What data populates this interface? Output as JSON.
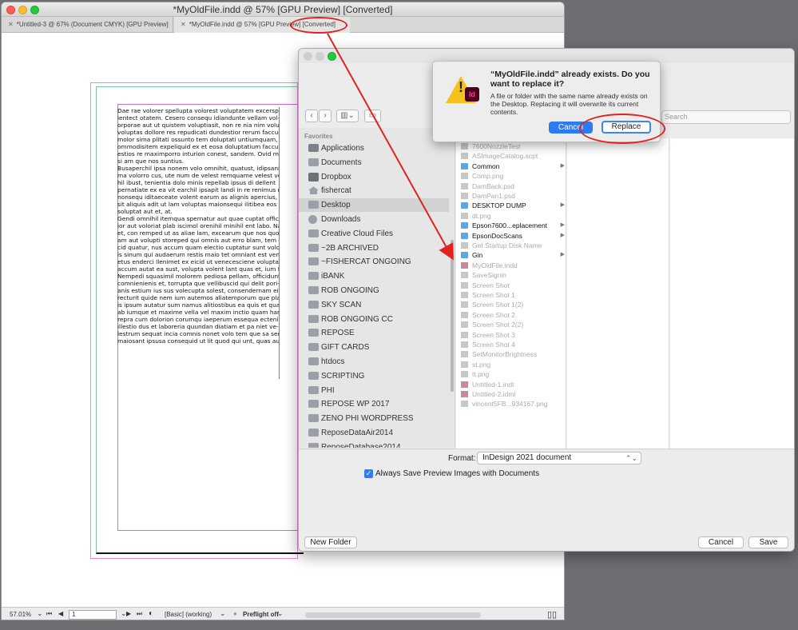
{
  "main_window": {
    "title": "*MyOldFile.indd @ 57% [GPU Preview] [Converted]",
    "tabs": [
      {
        "label": "*Untitled-3 @ 67% (Document CMYK) [GPU Preview]"
      },
      {
        "label": "*MyOldFile.indd @ 57% [GPU Preview] [Converted]"
      }
    ],
    "text_lines": [
      "Dae rae volorer spellupta volorest voluptatem excersp",
      "ientect otatem. Cesero consequ idiandunte vellam vol-",
      "orporae aut ut quistem voluptiasit, non re nia nim volupta",
      "voluptas dollore res repudicati dundestior rerum faccus",
      "molor sima plitati ossunto tem doluptati untiumquam,",
      "ommodisitem expeliquid ex et eosa doluptatium faccull",
      "estios re maximporro inturion conest, sandem. Ovid molor",
      "si am que nos suntius.",
      "Busaperchil ipsa nonem volo omnihit, quatust, idipsanis",
      "ma volorro cus, ute num de velest remquame velest veni-",
      "hil ibust, tenientia dolo minis repellab ipsus di dellent",
      "pernatiate ex ea vit earchil ipsapit landi in re renimus ne",
      "nonsequ iditaeceate volent earum as alignis apercius,",
      "sit aliquis adit ut lam voluptas maionsequi ilitibea eos",
      "soluptat aut et, at.",
      "Gendi omnihil itemqua spernatur aut quae cuptat officid-",
      "ior aut voloriat plab iscimol orenihil minihil ent labo. Nam",
      "et, con remped ut as aliae lam, excearum que nos quodit",
      "am aut volupti storeped qui omnis aut erro blam, tem quis-",
      "cid quatur, nus accum quam electio cuptatur sunt volorem",
      "is sinum qui audaerum restis maio tet omniant est vent",
      "etus enderci llenimet ex eicid ut venecesciene voluptati",
      "accum autat ea sust, volupta volent lant quas et, ium fuga.",
      "Nempedi squasimil molorem pediosa pellam, officidunti",
      "comnienienis et, torrupta que vellibuscid qui delit pori-",
      "anis estium ius sus volecupta solest, consendernam eium",
      "recturit quide nem ium autemos aliatemporum que plab",
      "is ipsum autatur sum namus alitiostibus ea quis et quam",
      "ab iumque et maxime vella vel maxim inctio quam harunt",
      "repra cum dolorion corumqu iaeperum essequa ectenih",
      "illestio dus et laboreria quundan diatiam et pa niet ve-",
      "lestrum sequat incia comnis nonet volo tem que sa sed",
      "maiosant ipsusa consequid ut lit quod qui unt, quas aut"
    ],
    "status": {
      "zoom": "57.01%",
      "page": "1",
      "style": "[Basic] (working)",
      "preflight": "Preflight off"
    }
  },
  "save_dialog": {
    "search_placeholder": "Search",
    "sidebar_header": "Favorites",
    "sidebar_items": [
      {
        "label": "Applications",
        "icon": "applications-icon"
      },
      {
        "label": "Documents",
        "icon": "documents-icon"
      },
      {
        "label": "Dropbox",
        "icon": "dropbox-icon"
      },
      {
        "label": "fishercat",
        "icon": "home-icon"
      },
      {
        "label": "Desktop",
        "icon": "desktop-icon",
        "selected": true
      },
      {
        "label": "Downloads",
        "icon": "downloads-icon"
      },
      {
        "label": "Creative Cloud Files",
        "icon": "folder-icon"
      },
      {
        "label": "~2B ARCHIVED",
        "icon": "folder-icon"
      },
      {
        "label": "~FISHERCAT ONGOING",
        "icon": "folder-icon"
      },
      {
        "label": "iBANK",
        "icon": "folder-icon"
      },
      {
        "label": "ROB ONGOING",
        "icon": "folder-icon"
      },
      {
        "label": "SKY SCAN",
        "icon": "folder-icon"
      },
      {
        "label": "ROB ONGOING CC",
        "icon": "folder-icon"
      },
      {
        "label": "REPOSE",
        "icon": "folder-icon"
      },
      {
        "label": "GIFT CARDS",
        "icon": "folder-icon"
      },
      {
        "label": "htdocs",
        "icon": "folder-icon"
      },
      {
        "label": "SCRIPTING",
        "icon": "folder-icon"
      },
      {
        "label": "PHI",
        "icon": "folder-icon"
      },
      {
        "label": "REPOSE WP 2017",
        "icon": "folder-icon"
      },
      {
        "label": "ZENO PHI WORDPRESS",
        "icon": "folder-icon"
      },
      {
        "label": "ReposeDataAir2014",
        "icon": "folder-icon"
      },
      {
        "label": "ReposeDatabase2014",
        "icon": "folder-icon"
      }
    ],
    "files": [
      {
        "name": "7600NozzleTest",
        "kind": "file"
      },
      {
        "name": "ASImageCatalog.scpt",
        "kind": "file"
      },
      {
        "name": "Common",
        "kind": "folder"
      },
      {
        "name": "Comp.png",
        "kind": "file"
      },
      {
        "name": "DamBack.psd",
        "kind": "file"
      },
      {
        "name": "DamPan1.psd",
        "kind": "file"
      },
      {
        "name": "DESKTOP DUMP",
        "kind": "folder"
      },
      {
        "name": "dt.png",
        "kind": "file"
      },
      {
        "name": "Epson7600...eplacement",
        "kind": "folder"
      },
      {
        "name": "EpsonDocScans",
        "kind": "folder"
      },
      {
        "name": "Get Startup Disk Name",
        "kind": "file"
      },
      {
        "name": "Gin",
        "kind": "folder"
      },
      {
        "name": "MyOldFile.indd",
        "kind": "indd"
      },
      {
        "name": "SaveSignin",
        "kind": "file"
      },
      {
        "name": "Screen Shot",
        "kind": "file"
      },
      {
        "name": "Screen Shot 1",
        "kind": "file"
      },
      {
        "name": "Screen Shot 1(2)",
        "kind": "file"
      },
      {
        "name": "Screen Shot 2",
        "kind": "file"
      },
      {
        "name": "Screen Shot 2(2)",
        "kind": "file"
      },
      {
        "name": "Screen Shot 3",
        "kind": "file"
      },
      {
        "name": "Screen Shot 4",
        "kind": "file"
      },
      {
        "name": "SetMonitorBrightness",
        "kind": "file"
      },
      {
        "name": "st.png",
        "kind": "file"
      },
      {
        "name": "tt.png",
        "kind": "file"
      },
      {
        "name": "Untitled-1.indt",
        "kind": "indd"
      },
      {
        "name": "Untitled-2.idml",
        "kind": "indd"
      },
      {
        "name": "vincent5FB...934167.png",
        "kind": "file"
      }
    ],
    "format_label": "Format:",
    "format_value": "InDesign 2021 document",
    "always_save_label": "Always Save Preview Images with Documents",
    "always_save_checked": true,
    "new_folder_label": "New Folder",
    "cancel_label": "Cancel",
    "save_label": "Save"
  },
  "alert": {
    "title": "“MyOldFile.indd” already exists. Do you want to replace it?",
    "body": "A file or folder with the same name already exists on the Desktop. Replacing it will overwrite its current contents.",
    "badge": "Id",
    "cancel_label": "Cancel",
    "replace_label": "Replace"
  },
  "colors": {
    "annotation_red": "#e0231f",
    "accent_blue": "#2b7cf4",
    "folder_blue": "#58a7e6"
  }
}
